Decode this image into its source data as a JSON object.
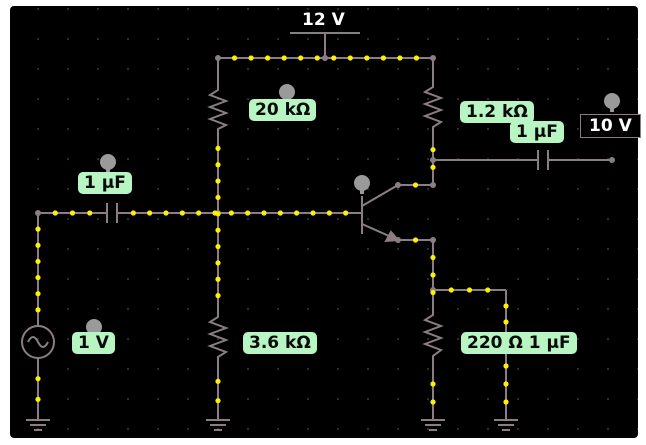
{
  "labels": {
    "supply": "12 V",
    "r_top_left": "20 kΩ",
    "r_collector": "1.2 kΩ",
    "cap_out": "1 μF",
    "out_voltage": "10 V",
    "cap_in": "1 μF",
    "source": "1 V",
    "r_bottom_left": "3.6 kΩ",
    "r_emitter_cap": "220 Ω 1 μF"
  },
  "colors": {
    "background": "#ffffff",
    "canvas": "#000000",
    "wire": "#8a7e84",
    "current_dot": "#ffef00",
    "label_bg": "#b7f5c2"
  }
}
